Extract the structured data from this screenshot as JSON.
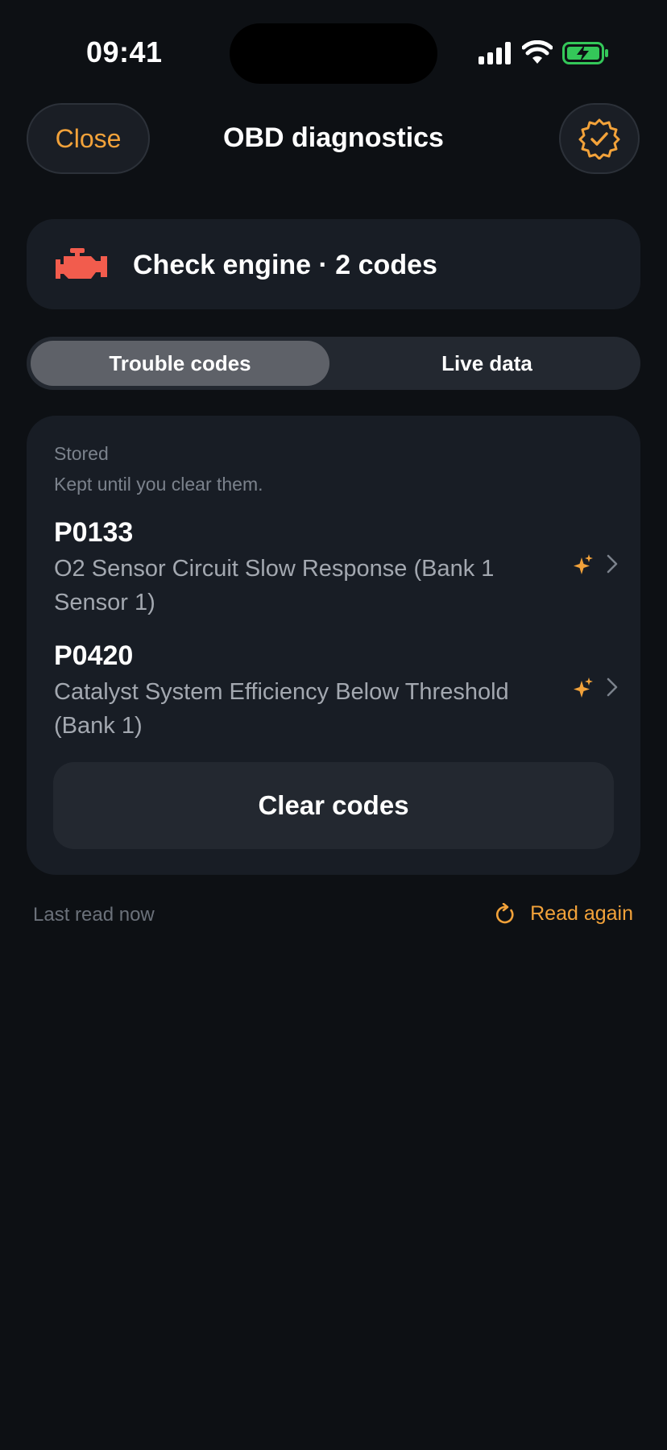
{
  "status_bar": {
    "time": "09:41",
    "icons": [
      "signal-icon",
      "wifi-icon",
      "battery-charging-icon"
    ]
  },
  "header": {
    "close_label": "Close",
    "title": "OBD diagnostics",
    "verify_icon": "verified-badge-icon"
  },
  "engine_banner": {
    "icon": "check-engine-icon",
    "text": "Check engine · 2 codes",
    "icon_color": "#f25c4d"
  },
  "tabs": [
    {
      "label": "Trouble codes",
      "selected": true
    },
    {
      "label": "Live data",
      "selected": false
    }
  ],
  "codes_section": {
    "title": "Stored",
    "subtitle": "Kept until you clear them.",
    "codes": [
      {
        "id": "P0133",
        "description": "O2 Sensor Circuit Slow Response (Bank 1 Sensor 1)"
      },
      {
        "id": "P0420",
        "description": "Catalyst System Efficiency Below Threshold (Bank 1)"
      }
    ],
    "clear_label": "Clear codes"
  },
  "footer": {
    "last_read": "Last read now",
    "read_again_label": "Read again"
  },
  "colors": {
    "accent": "#f2a23a",
    "background": "#0d1014",
    "card": "#181d25",
    "battery": "#34c759"
  }
}
